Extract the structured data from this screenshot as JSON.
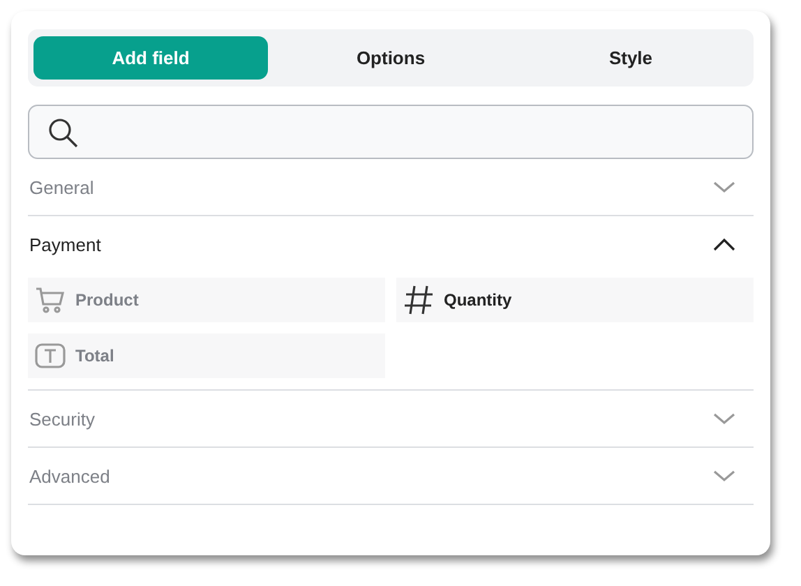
{
  "tabs": [
    {
      "label": "Add field",
      "selected": true
    },
    {
      "label": "Options",
      "selected": false
    },
    {
      "label": "Style",
      "selected": false
    }
  ],
  "sections": [
    {
      "title": "General",
      "expanded": false,
      "disabled": true
    },
    {
      "title": "Payment",
      "expanded": true,
      "disabled": false,
      "fields": [
        {
          "label": "Product",
          "kind": "cart",
          "disabled": true
        },
        {
          "label": "Quantity",
          "kind": "number",
          "disabled": false
        },
        {
          "label": "Total",
          "kind": "text",
          "disabled": true
        }
      ]
    },
    {
      "title": "Security",
      "expanded": false,
      "disabled": true
    },
    {
      "title": "Advanced",
      "expanded": false,
      "disabled": true
    }
  ]
}
